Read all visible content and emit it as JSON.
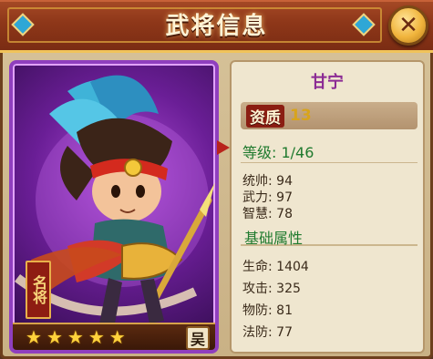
{
  "window": {
    "title": "武将信息",
    "close_icon": "close-icon"
  },
  "hero": {
    "name": "甘宁",
    "aptitude_label": "资质",
    "aptitude_value": "13",
    "seal_text": "名将",
    "faction": "吴",
    "stars": 5
  },
  "stats": {
    "level": "等级: 1/46",
    "command": "统帅: 94",
    "force": "武力: 97",
    "intelligence": "智慧: 78"
  },
  "base_attributes": {
    "heading": "基础属性",
    "hp": "生命: 1404",
    "attack": "攻击: 325",
    "phys_def": "物防: 81",
    "mag_def": "法防: 77"
  },
  "colors": {
    "title_bar": "#8e3719",
    "card_purple": "#6a1e96",
    "name_purple": "#8b2a94",
    "green_text": "#1f7a2e",
    "star_gold": "#ffd23c"
  }
}
